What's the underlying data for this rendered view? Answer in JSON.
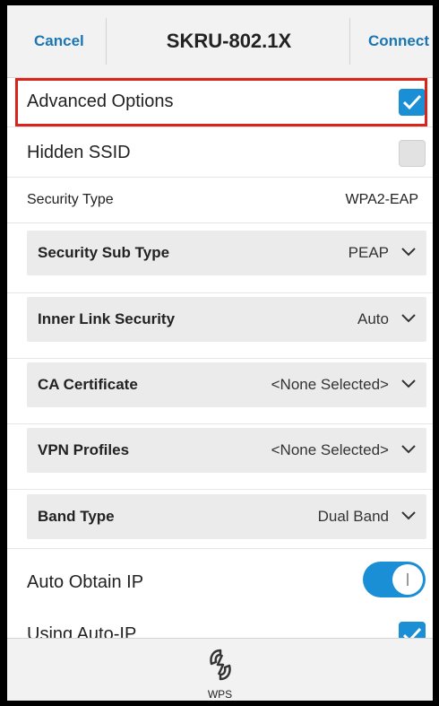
{
  "header": {
    "cancel_label": "Cancel",
    "title": "SKRU-802.1X",
    "connect_label": "Connect"
  },
  "advanced_options": {
    "label": "Advanced Options",
    "checked": true
  },
  "hidden_ssid": {
    "label": "Hidden SSID",
    "checked": false
  },
  "security_type": {
    "label": "Security Type",
    "value": "WPA2-EAP"
  },
  "dropdowns": [
    {
      "label": "Security Sub Type",
      "value": "PEAP"
    },
    {
      "label": "Inner Link Security",
      "value": "Auto"
    },
    {
      "label": "CA Certificate",
      "value": "<None Selected>"
    },
    {
      "label": "VPN Profiles",
      "value": "<None Selected>"
    },
    {
      "label": "Band Type",
      "value": "Dual Band"
    }
  ],
  "auto_obtain_ip": {
    "label": "Auto Obtain IP",
    "on": true
  },
  "using_auto_ip": {
    "label": "Using Auto-IP",
    "checked": true
  },
  "bottom_bar": {
    "wps_label": "WPS",
    "wps_icon": "wps-icon"
  },
  "colors": {
    "accent": "#1a8fd6",
    "link": "#1a76b2",
    "highlight": "#d9241c"
  }
}
